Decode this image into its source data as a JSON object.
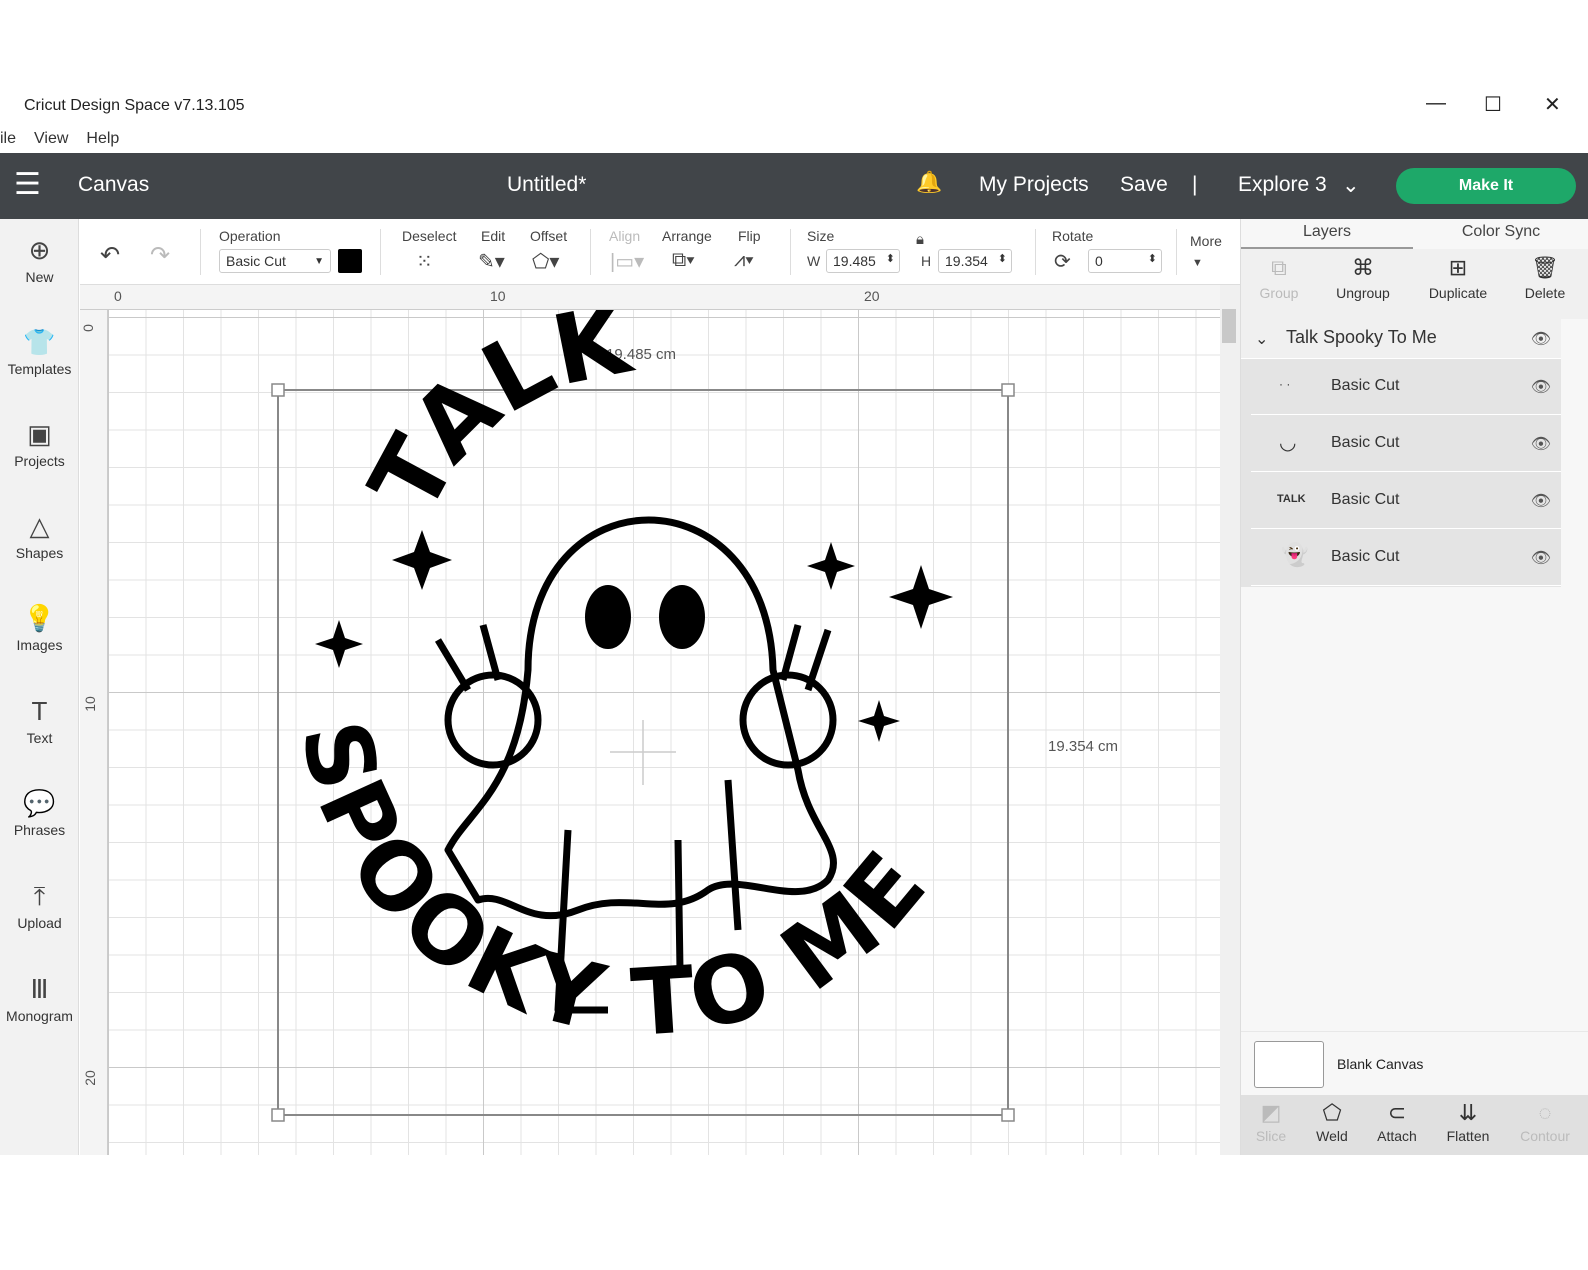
{
  "window": {
    "title": "Cricut Design Space  v7.13.105",
    "min": "—",
    "max": "☐",
    "close": "✕"
  },
  "menu": [
    "ile",
    "View",
    "Help"
  ],
  "header": {
    "section": "Canvas",
    "doc_title": "Untitled*",
    "my_projects": "My Projects",
    "save": "Save",
    "divider": "|",
    "machine": "Explore 3",
    "make_it": "Make It"
  },
  "sidebar": [
    {
      "label": "New",
      "icon": "⊕"
    },
    {
      "label": "Templates",
      "icon": "👕"
    },
    {
      "label": "Projects",
      "icon": "▣"
    },
    {
      "label": "Shapes",
      "icon": "△"
    },
    {
      "label": "Images",
      "icon": "💡"
    },
    {
      "label": "Text",
      "icon": "T"
    },
    {
      "label": "Phrases",
      "icon": "💬"
    },
    {
      "label": "Upload",
      "icon": "⤒"
    },
    {
      "label": "Monogram",
      "icon": "Ⅲ"
    }
  ],
  "toolbar": {
    "operation_label": "Operation",
    "operation_value": "Basic Cut",
    "color": "#000000",
    "deselect": "Deselect",
    "edit": "Edit",
    "offset": "Offset",
    "align": "Align",
    "arrange": "Arrange",
    "flip": "Flip",
    "size": "Size",
    "w_label": "W",
    "w_value": "19.485",
    "h_label": "H",
    "h_value": "19.354",
    "rotate": "Rotate",
    "rotate_value": "0",
    "more": "More"
  },
  "rulers": {
    "x": [
      "0",
      "10",
      "20"
    ],
    "y": [
      "0",
      "10",
      "20"
    ]
  },
  "canvas": {
    "width_label": "19.485 cm",
    "height_label": "19.354 cm",
    "art_top": "TALK",
    "art_bottom": "SPOOKY TO ME"
  },
  "panel": {
    "tabs": [
      "Layers",
      "Color Sync"
    ],
    "actions": [
      {
        "label": "Group",
        "icon": "⧉"
      },
      {
        "label": "Ungroup",
        "icon": "⌘"
      },
      {
        "label": "Duplicate",
        "icon": "⊞"
      },
      {
        "label": "Delete",
        "icon": "🗑"
      }
    ],
    "group_name": "Talk Spooky To Me",
    "layers": [
      "Basic Cut",
      "Basic Cut",
      "Basic Cut",
      "Basic Cut"
    ],
    "layer_thumbs": [
      "· ·",
      "◡",
      "TALK",
      "👻"
    ],
    "blank_canvas": "Blank Canvas",
    "bottom": [
      {
        "label": "Slice",
        "icon": "◩"
      },
      {
        "label": "Weld",
        "icon": "⬠"
      },
      {
        "label": "Attach",
        "icon": "⊂"
      },
      {
        "label": "Flatten",
        "icon": "⇊"
      },
      {
        "label": "Contour",
        "icon": "◌"
      }
    ]
  }
}
